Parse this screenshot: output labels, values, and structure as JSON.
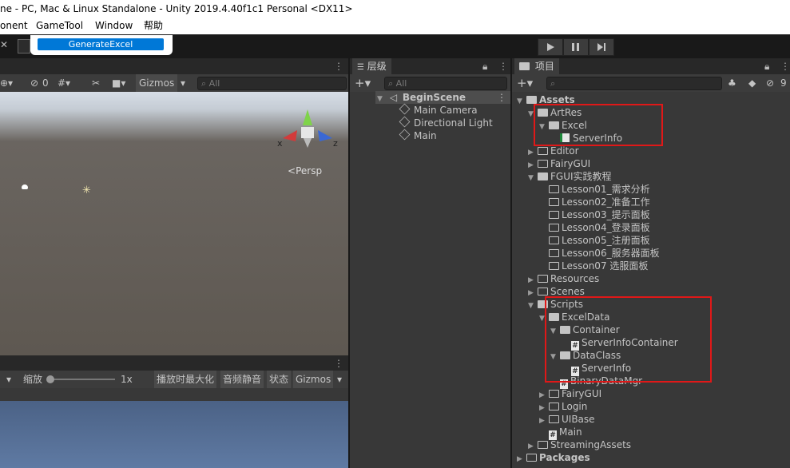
{
  "window": {
    "title": "ne - PC, Mac & Linux Standalone - Unity 2019.4.40f1c1 Personal <DX11>"
  },
  "menu": {
    "items": [
      "onent",
      "GameTool",
      "Window",
      "帮助"
    ]
  },
  "dropdown": {
    "item": "GenerateExcel"
  },
  "scene": {
    "badge_count": "0",
    "gizmos": "Gizmos",
    "search_placeholder": "All",
    "axis_x": "x",
    "axis_z": "z",
    "persp": "Persp"
  },
  "game": {
    "scale_label": "缩放",
    "scale_value": "1x",
    "maximize": "播放时最大化",
    "mute": "音频静音",
    "stats": "状态",
    "gizmos": "Gizmos"
  },
  "hierarchy": {
    "tab": "层级",
    "search_placeholder": "All",
    "scene": "BeginScene",
    "objects": [
      "Main Camera",
      "Directional Light",
      "Main"
    ]
  },
  "project": {
    "tab": "项目",
    "hidden_count": "9",
    "tree": [
      {
        "label": "Assets",
        "depth": 0,
        "type": "folder",
        "open": true,
        "bold": true
      },
      {
        "label": "ArtRes",
        "depth": 1,
        "type": "folder",
        "open": true
      },
      {
        "label": "Excel",
        "depth": 2,
        "type": "folder",
        "open": true
      },
      {
        "label": "ServerInfo",
        "depth": 3,
        "type": "excel"
      },
      {
        "label": "Editor",
        "depth": 1,
        "type": "folder",
        "open": false
      },
      {
        "label": "FairyGUI",
        "depth": 1,
        "type": "folder",
        "open": false
      },
      {
        "label": "FGUI实践教程",
        "depth": 1,
        "type": "folder",
        "open": true
      },
      {
        "label": "Lesson01_需求分析",
        "depth": 2,
        "type": "folder-leaf"
      },
      {
        "label": "Lesson02_准备工作",
        "depth": 2,
        "type": "folder-leaf"
      },
      {
        "label": "Lesson03_提示面板",
        "depth": 2,
        "type": "folder-leaf"
      },
      {
        "label": "Lesson04_登录面板",
        "depth": 2,
        "type": "folder-leaf"
      },
      {
        "label": "Lesson05_注册面板",
        "depth": 2,
        "type": "folder-leaf"
      },
      {
        "label": "Lesson06_服务器面板",
        "depth": 2,
        "type": "folder-leaf"
      },
      {
        "label": "Lesson07 选服面板",
        "depth": 2,
        "type": "folder-leaf"
      },
      {
        "label": "Resources",
        "depth": 1,
        "type": "folder",
        "open": false
      },
      {
        "label": "Scenes",
        "depth": 1,
        "type": "folder",
        "open": false
      },
      {
        "label": "Scripts",
        "depth": 1,
        "type": "folder",
        "open": true
      },
      {
        "label": "ExcelData",
        "depth": 2,
        "type": "folder",
        "open": true
      },
      {
        "label": "Container",
        "depth": 3,
        "type": "folder",
        "open": true
      },
      {
        "label": "ServerInfoContainer",
        "depth": 4,
        "type": "script"
      },
      {
        "label": "DataClass",
        "depth": 3,
        "type": "folder",
        "open": true
      },
      {
        "label": "ServerInfo",
        "depth": 4,
        "type": "script"
      },
      {
        "label": "BinaryDataMgr",
        "depth": 3,
        "type": "script"
      },
      {
        "label": "FairyGUI",
        "depth": 2,
        "type": "folder",
        "open": false
      },
      {
        "label": "Login",
        "depth": 2,
        "type": "folder",
        "open": false
      },
      {
        "label": "UIBase",
        "depth": 2,
        "type": "folder",
        "open": false
      },
      {
        "label": "Main",
        "depth": 2,
        "type": "script"
      },
      {
        "label": "StreamingAssets",
        "depth": 1,
        "type": "folder",
        "open": false
      },
      {
        "label": "Packages",
        "depth": 0,
        "type": "folder",
        "open": false,
        "bold": true
      }
    ]
  },
  "colors": {
    "highlight": "#0078d7",
    "annotation": "#e01818",
    "scene_sky": "#c9d3de",
    "scene_ground": "#5e5851"
  }
}
